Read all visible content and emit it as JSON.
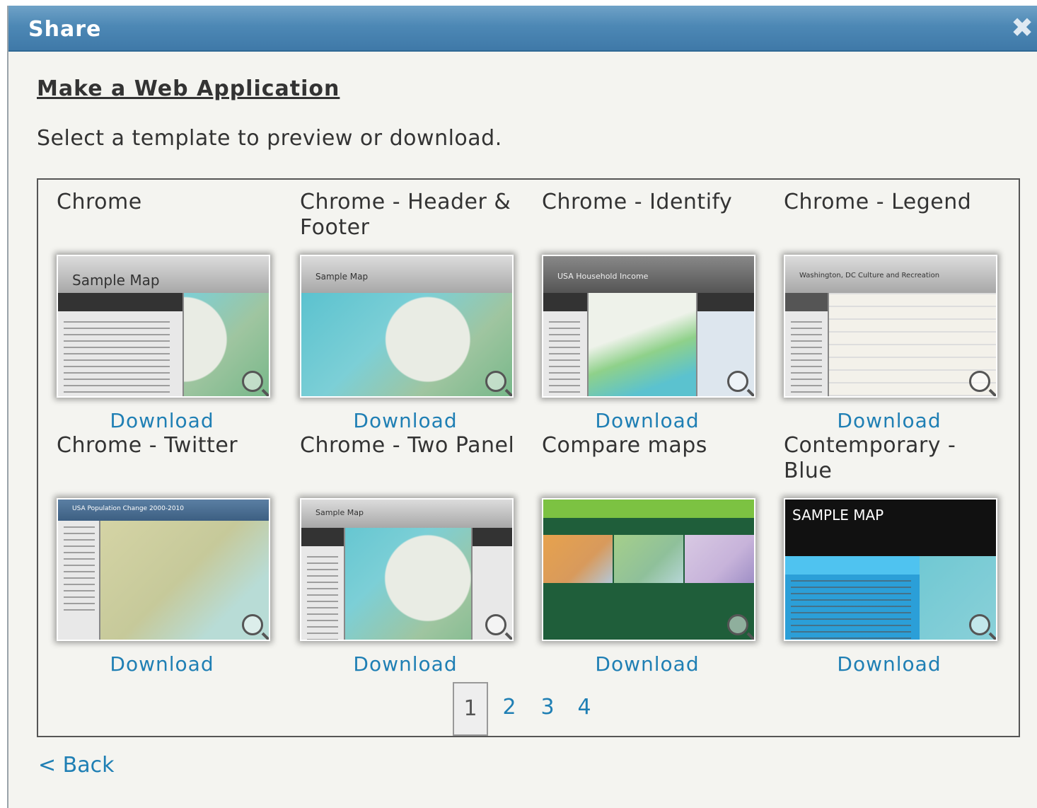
{
  "dialog": {
    "title": "Share",
    "close_icon": "close-icon"
  },
  "heading": "Make a Web Application",
  "subheading": "Select a template to preview or download.",
  "templates": [
    {
      "title": "Chrome",
      "thumb_text": "Sample Map",
      "download_label": "Download",
      "style": "sidebar"
    },
    {
      "title": "Chrome - Header & Footer",
      "thumb_text": "Sample Map",
      "download_label": "Download",
      "style": "fullmap"
    },
    {
      "title": "Chrome - Identify",
      "thumb_text": "USA Household Income",
      "download_label": "Download",
      "style": "sidebar"
    },
    {
      "title": "Chrome - Legend",
      "thumb_text": "Washington, DC Culture and Recreation",
      "download_label": "Download",
      "style": "sidebar"
    },
    {
      "title": "Chrome - Twitter",
      "thumb_text": "USA Population Change 2000-2010",
      "download_label": "Download",
      "style": "sidebar"
    },
    {
      "title": "Chrome - Two Panel",
      "thumb_text": "Sample Map",
      "download_label": "Download",
      "style": "sidebar"
    },
    {
      "title": "Compare maps",
      "thumb_text": "",
      "download_label": "Download",
      "style": "compare"
    },
    {
      "title": "Contemporary - Blue",
      "thumb_text": "SAMPLE MAP",
      "download_label": "Download",
      "style": "dark"
    }
  ],
  "pagination": {
    "current": "1",
    "pages": [
      "2",
      "3",
      "4"
    ]
  },
  "back_label": "< Back",
  "colors": {
    "titlebar": "#4d88b5",
    "link": "#1f7fb4",
    "background": "#f4f4f0"
  }
}
